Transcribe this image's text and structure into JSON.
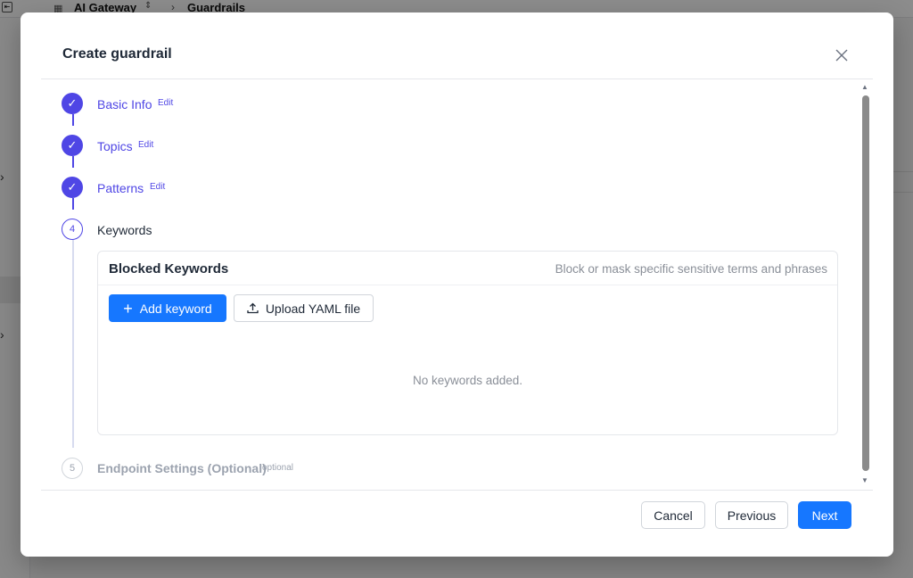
{
  "background": {
    "breadcrumb": [
      "AI Gateway",
      "Guardrails"
    ]
  },
  "modal": {
    "title": "Create guardrail",
    "steps": [
      {
        "number": "1",
        "label": "Basic Info",
        "status": "done",
        "edit_label": "Edit"
      },
      {
        "number": "2",
        "label": "Topics",
        "status": "done",
        "edit_label": "Edit"
      },
      {
        "number": "3",
        "label": "Patterns",
        "status": "done",
        "edit_label": "Edit"
      },
      {
        "number": "4",
        "label": "Keywords",
        "status": "active"
      },
      {
        "number": "5",
        "label": "Endpoint Settings (Optional)",
        "status": "pending",
        "optional_label": "optional"
      }
    ],
    "keywords_card": {
      "title": "Blocked Keywords",
      "description": "Block or mask specific sensitive terms and phrases",
      "add_button": "Add keyword",
      "upload_button": "Upload YAML file",
      "empty_message": "No keywords added."
    },
    "footer": {
      "cancel": "Cancel",
      "previous": "Previous",
      "next": "Next"
    }
  },
  "colors": {
    "accent": "#4f46e5",
    "primary_button": "#1677ff"
  }
}
